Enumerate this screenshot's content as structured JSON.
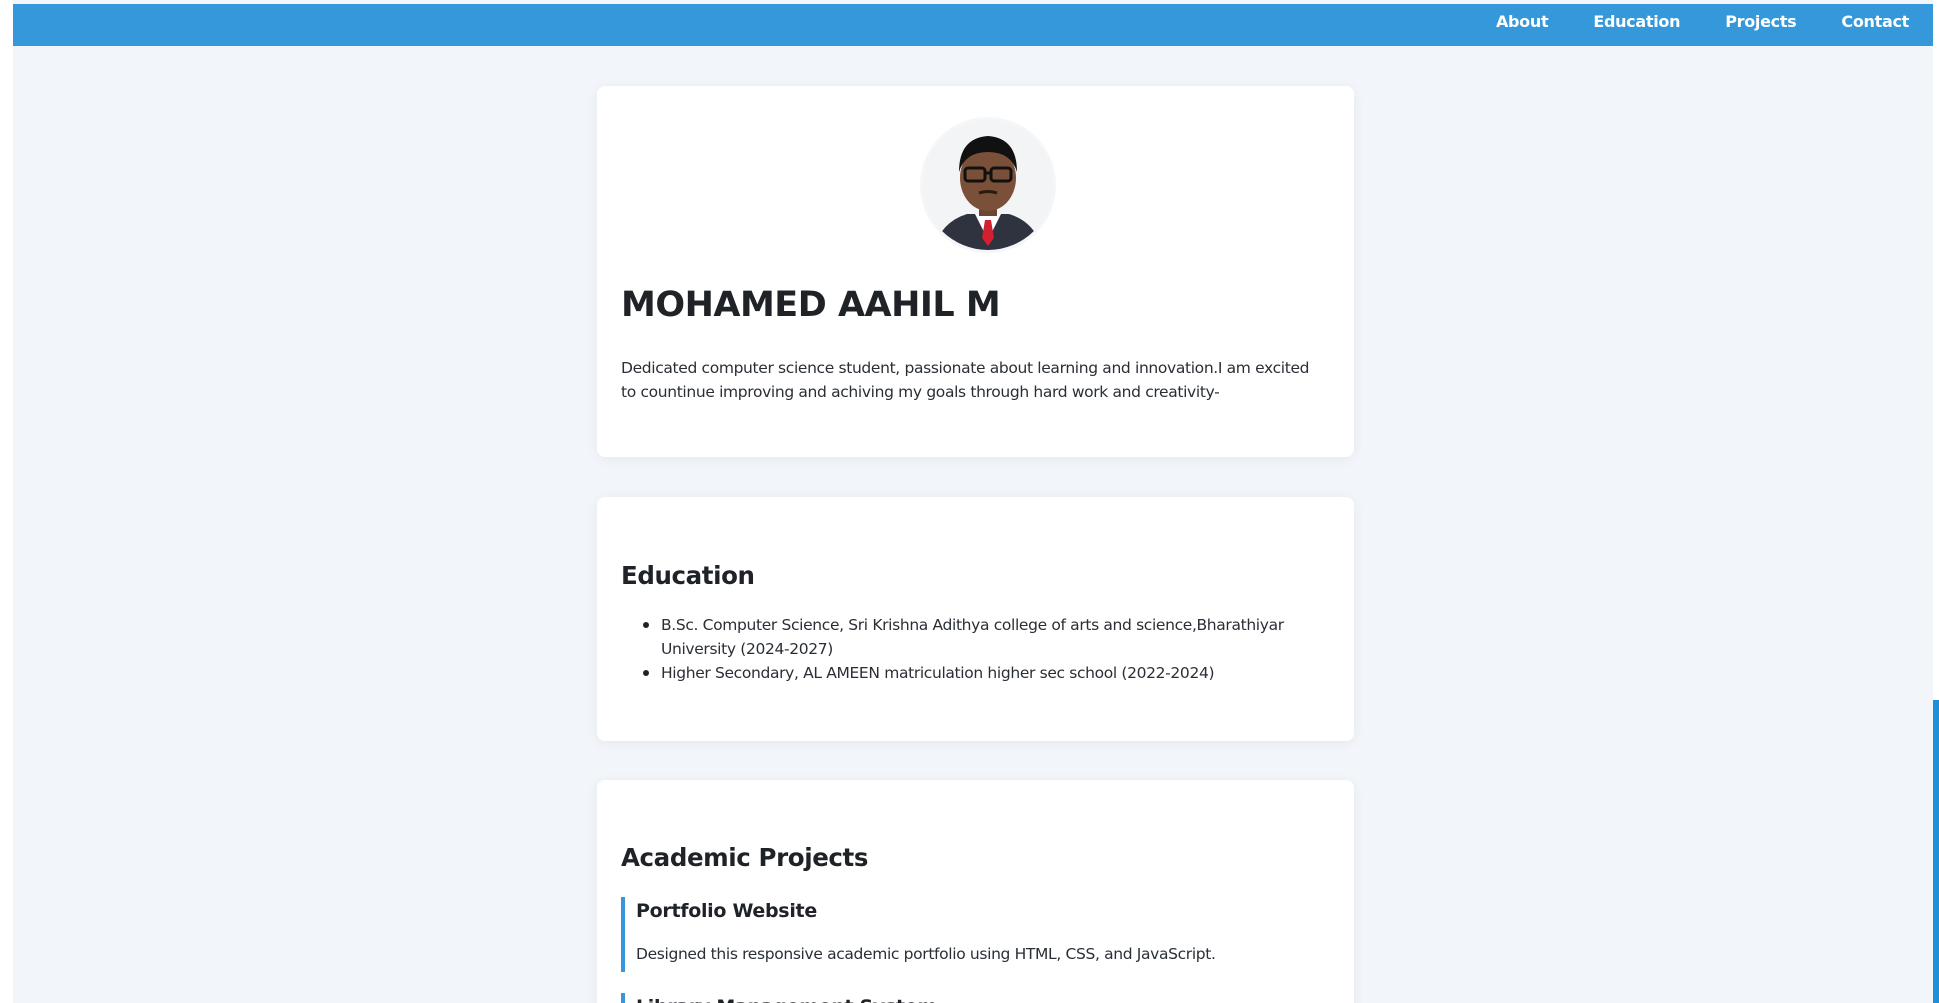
{
  "nav": {
    "items": [
      {
        "label": "About"
      },
      {
        "label": "Education"
      },
      {
        "label": "Projects"
      },
      {
        "label": "Contact"
      }
    ]
  },
  "profile": {
    "name": "MOHAMED AAHIL M",
    "bio": "Dedicated computer science student, passionate about learning and innovation.I am excited to countinue improving and achiving my goals through hard work and creativity-"
  },
  "education": {
    "title": "Education",
    "items": [
      {
        "text": "B.Sc. Computer Science, Sri Krishna Adithya college of arts and science,Bharathiyar University (2024-2027)"
      },
      {
        "text": "Higher Secondary, AL AMEEN matriculation higher sec school (2022-2024)"
      }
    ]
  },
  "projects": {
    "title": "Academic Projects",
    "items": [
      {
        "name": "Portfolio Website",
        "description": "Designed this responsive academic portfolio using HTML, CSS, and JavaScript."
      },
      {
        "name": "Library Management System",
        "description": ""
      }
    ]
  },
  "colors": {
    "accent": "#3498db",
    "page_background": "#f2f5f9",
    "card_background": "#ffffff",
    "text": "#1f2328"
  }
}
